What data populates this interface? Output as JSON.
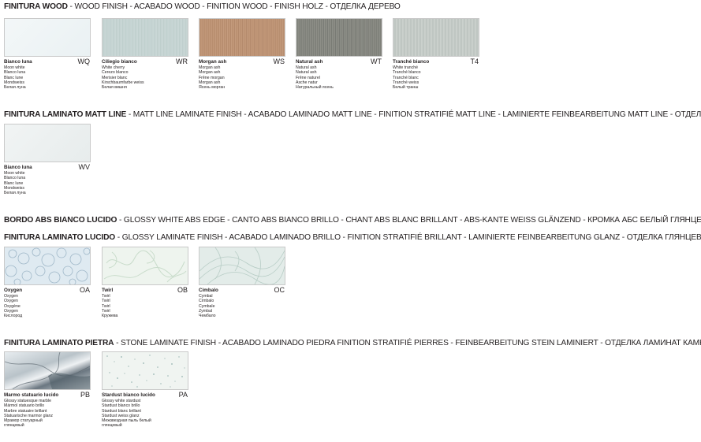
{
  "sections": {
    "wood": {
      "title": "FINITURA WOOD",
      "rest": " - WOOD FINISH - ACABADO WOOD - FINITION WOOD - FINISH HOLZ - ОТДЕЛКА ДЕРЕВО"
    },
    "matt": {
      "title": "FINITURA LAMINATO MATT LINE",
      "rest": " - MATT LINE LAMINATE FINISH - ACABADO LAMINADO MATT LINE - FINITION STRATIFIÉ MATT LINE - LAMINIERTE FEINBEARBEITUNG MATT LINE - ОТДЕЛКА ЛАМИНА"
    },
    "abs": {
      "title": "BORDO ABS BIANCO LUCIDO",
      "rest": " - GLOSSY WHITE ABS EDGE - CANTO ABS BIANCO BRILLO - CHANT ABS BLANC BRILLANT - ABS-KANTE WEISS GLÄNZEND - КРОМКА АБС БЕЛЫЙ ГЛЯНЦЕВЫЙ"
    },
    "glossy": {
      "title": "FINITURA LAMINATO LUCIDO",
      "rest": " - GLOSSY LAMINATE FINISH - ACABADO LAMINADO BRILLO - FINITION STRATIFIÉ BRILLANT - LAMINIERTE FEINBEARBEITUNG GLANZ - ОТДЕЛКА ГЛЯНЦЕВЫЙ ЛАМИН"
    },
    "stone": {
      "title": "FINITURA LAMINATO PIETRA",
      "rest": " - STONE LAMINATE FINISH - ACABADO LAMINADO PIEDRA  FINITION STRATIFIÉ PIERRES - FEINBEARBEITUNG STEIN LAMINIERT - ОТДЕЛКА ЛАМИНАТ КАМН"
    }
  },
  "swatches": {
    "wq": {
      "name": "Bianco luna",
      "code": "WQ",
      "lines": [
        "Moon white",
        "Blanco luna",
        "Blanc lune",
        "Mondweiss",
        "Белая луна"
      ]
    },
    "wr": {
      "name": "Ciliegio bianco",
      "code": "WR",
      "lines": [
        "White cherry",
        "Cerezo blanco",
        "Merisier blanc",
        "Kirschbaumfarbe weiss",
        "Белая вишня"
      ]
    },
    "ws": {
      "name": "Morgan ash",
      "code": "WS",
      "lines": [
        "Morgan ash",
        "Morgan ash",
        "Frêne morgan",
        "Morgan ash",
        "Ясень морган"
      ]
    },
    "wt": {
      "name": "Natural ash",
      "code": "WT",
      "lines": [
        "Natural ash",
        "Natural ash",
        "Frêne naturel",
        "Asche natur",
        "Натуральный ясень"
      ]
    },
    "t4": {
      "name": "Tranché bianco",
      "code": "T4",
      "lines": [
        "White tranché",
        "Tranché blanco",
        "Tranché blanc",
        "Tranché weiss",
        "Белый транш"
      ]
    },
    "wv": {
      "name": "Bianco luna",
      "code": "WV",
      "lines": [
        "Moon white",
        "Blanco luna",
        "Blanc lune",
        "Mondweiss",
        "Белая луна"
      ]
    },
    "oa": {
      "name": "Oxygen",
      "code": "OA",
      "lines": [
        "Oxygen",
        "Oxygen",
        "Oxygène",
        "Oxygen",
        "Кислород"
      ]
    },
    "ob": {
      "name": "Twirl",
      "code": "OB",
      "lines": [
        "Twirl",
        "Twirl",
        "Twirl",
        "Twirl",
        "Кружева"
      ]
    },
    "oc": {
      "name": "Cimbalo",
      "code": "OC",
      "lines": [
        "Cymbal",
        "Címbalo",
        "Cymbale",
        "Zymbal",
        "Чембало"
      ]
    },
    "pb": {
      "name": "Marmo statuario lucido",
      "code": "PB",
      "lines": [
        "Glossy statuesque marble",
        "Mármol statuario brillo",
        "Marbre statuaire brillant",
        "Statuarische marmor glanz",
        "Мрамор статуарный",
        "глянцевый"
      ]
    },
    "pa": {
      "name": "Stardust bianco lucido",
      "code": "PA",
      "lines": [
        "Glossy white stardust",
        "Stardust blanco brillo",
        "Stardust blanc brillant",
        "Stardust weiss glanz",
        "Межзвездная пыль белый",
        "глянцевый"
      ]
    }
  }
}
